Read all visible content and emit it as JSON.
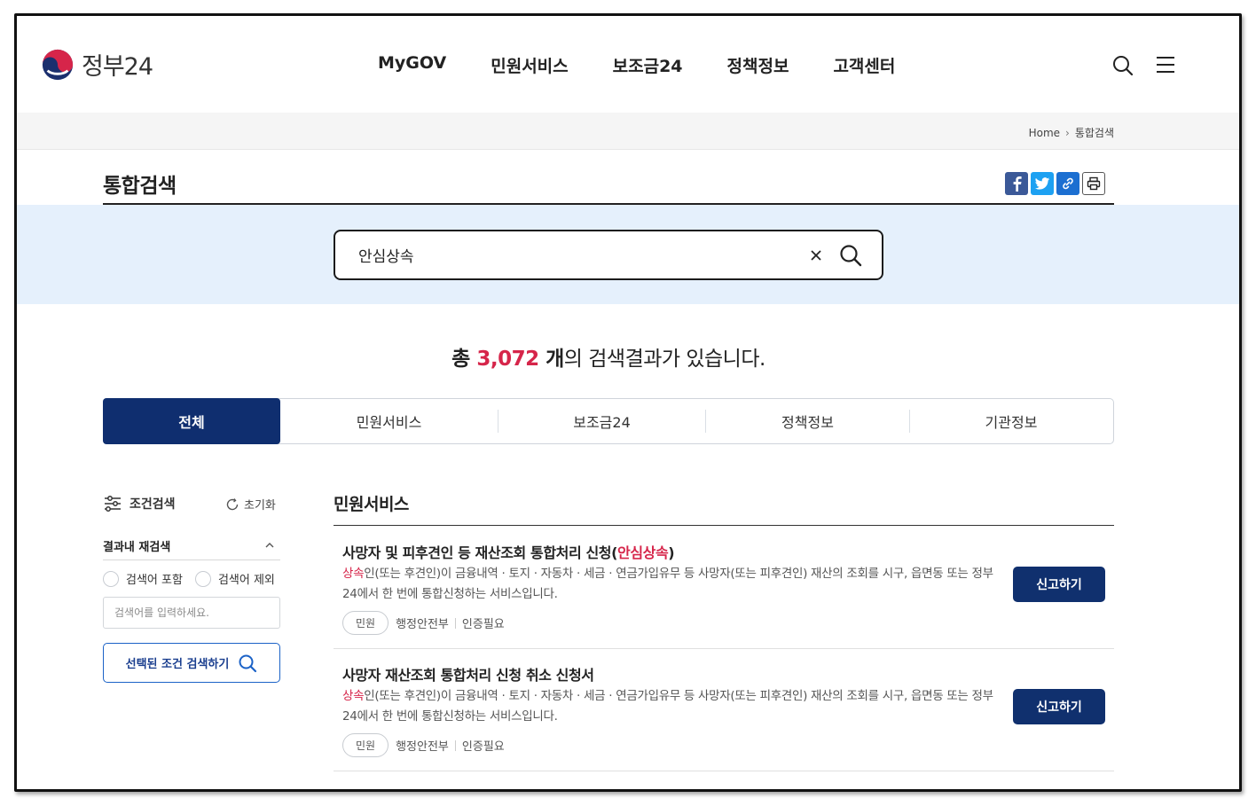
{
  "header": {
    "logo_text": "정부24",
    "nav": [
      "MyGOV",
      "민원서비스",
      "보조금24",
      "정책정보",
      "고객센터"
    ]
  },
  "breadcrumb": {
    "home": "Home",
    "current": "통합검색"
  },
  "page_title": "통합검색",
  "search": {
    "value": "안심상속"
  },
  "summary": {
    "prefix": "총 ",
    "count": "3,072",
    "unit": " 개",
    "suffix": "의 검색결과가 있습니다."
  },
  "tabs": [
    {
      "label": "전체",
      "active": true
    },
    {
      "label": "민원서비스",
      "active": false
    },
    {
      "label": "보조금24",
      "active": false
    },
    {
      "label": "정책정보",
      "active": false
    },
    {
      "label": "기관정보",
      "active": false
    }
  ],
  "filter": {
    "title": "조건검색",
    "reset": "초기화",
    "refine_title": "결과내 재검색",
    "include_label": "검색어 포함",
    "exclude_label": "검색어 제외",
    "input_placeholder": "검색어를 입력하세요.",
    "submit_label": "선택된 조건 검색하기"
  },
  "section_title": "민원서비스",
  "results": [
    {
      "title_pre": "사망자 및 피후견인 등 재산조회 통합처리 신청(",
      "title_hl": "안심상속",
      "title_post": ")",
      "desc_hl": "상속",
      "desc": "인(또는 후견인)이 금융내역 · 토지 · 자동차 · 세금 · 연금가입유무 등 사망자(또는 피후견인) 재산의 조회를 시구, 읍면동 또는 정부24에서 한 번에 통합신청하는 서비스입니다.",
      "chip": "민원",
      "agency": "행정안전부",
      "auth": "인증필요",
      "button": "신고하기"
    },
    {
      "title_pre": "사망자 재산조회 통합처리 신청 취소 신청서",
      "title_hl": "",
      "title_post": "",
      "desc_hl": "상속",
      "desc": "인(또는 후견인)이 금융내역 · 토지 · 자동차 · 세금 · 연금가입유무 등 사망자(또는 피후견인) 재산의 조회를 시구, 읍면동 또는 정부24에서 한 번에 통합신청하는 서비스입니다.",
      "chip": "민원",
      "agency": "행정안전부",
      "auth": "인증필요",
      "button": "신고하기"
    }
  ],
  "colors": {
    "navy": "#0f2e6f",
    "highlight": "#d6254a",
    "band": "#e5f0fc",
    "facebook": "#3b5998",
    "twitter": "#1da1f2",
    "link": "#1c6fd1"
  }
}
